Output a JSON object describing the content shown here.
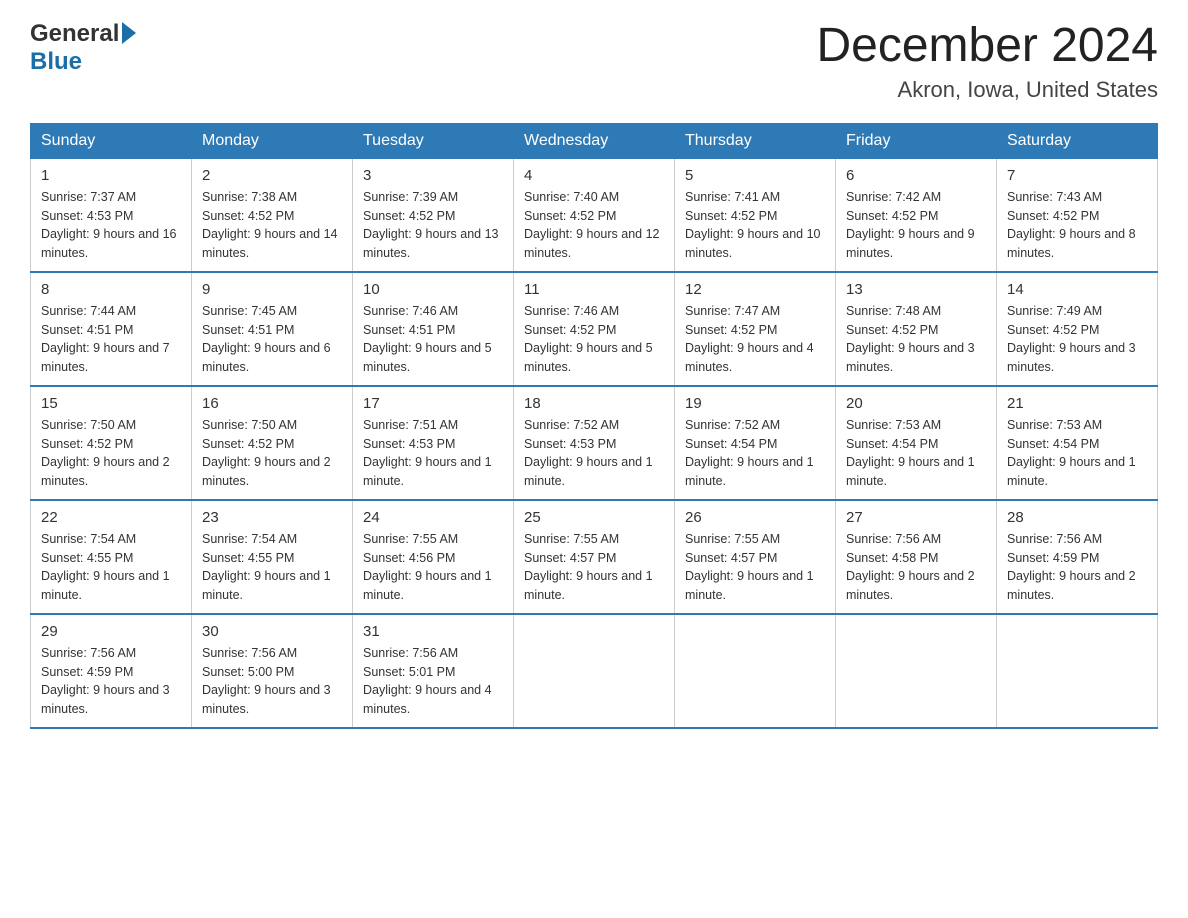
{
  "logo": {
    "general": "General",
    "blue": "Blue"
  },
  "title": "December 2024",
  "subtitle": "Akron, Iowa, United States",
  "days_of_week": [
    "Sunday",
    "Monday",
    "Tuesday",
    "Wednesday",
    "Thursday",
    "Friday",
    "Saturday"
  ],
  "weeks": [
    [
      {
        "num": "1",
        "sunrise": "7:37 AM",
        "sunset": "4:53 PM",
        "daylight": "9 hours and 16 minutes."
      },
      {
        "num": "2",
        "sunrise": "7:38 AM",
        "sunset": "4:52 PM",
        "daylight": "9 hours and 14 minutes."
      },
      {
        "num": "3",
        "sunrise": "7:39 AM",
        "sunset": "4:52 PM",
        "daylight": "9 hours and 13 minutes."
      },
      {
        "num": "4",
        "sunrise": "7:40 AM",
        "sunset": "4:52 PM",
        "daylight": "9 hours and 12 minutes."
      },
      {
        "num": "5",
        "sunrise": "7:41 AM",
        "sunset": "4:52 PM",
        "daylight": "9 hours and 10 minutes."
      },
      {
        "num": "6",
        "sunrise": "7:42 AM",
        "sunset": "4:52 PM",
        "daylight": "9 hours and 9 minutes."
      },
      {
        "num": "7",
        "sunrise": "7:43 AM",
        "sunset": "4:52 PM",
        "daylight": "9 hours and 8 minutes."
      }
    ],
    [
      {
        "num": "8",
        "sunrise": "7:44 AM",
        "sunset": "4:51 PM",
        "daylight": "9 hours and 7 minutes."
      },
      {
        "num": "9",
        "sunrise": "7:45 AM",
        "sunset": "4:51 PM",
        "daylight": "9 hours and 6 minutes."
      },
      {
        "num": "10",
        "sunrise": "7:46 AM",
        "sunset": "4:51 PM",
        "daylight": "9 hours and 5 minutes."
      },
      {
        "num": "11",
        "sunrise": "7:46 AM",
        "sunset": "4:52 PM",
        "daylight": "9 hours and 5 minutes."
      },
      {
        "num": "12",
        "sunrise": "7:47 AM",
        "sunset": "4:52 PM",
        "daylight": "9 hours and 4 minutes."
      },
      {
        "num": "13",
        "sunrise": "7:48 AM",
        "sunset": "4:52 PM",
        "daylight": "9 hours and 3 minutes."
      },
      {
        "num": "14",
        "sunrise": "7:49 AM",
        "sunset": "4:52 PM",
        "daylight": "9 hours and 3 minutes."
      }
    ],
    [
      {
        "num": "15",
        "sunrise": "7:50 AM",
        "sunset": "4:52 PM",
        "daylight": "9 hours and 2 minutes."
      },
      {
        "num": "16",
        "sunrise": "7:50 AM",
        "sunset": "4:52 PM",
        "daylight": "9 hours and 2 minutes."
      },
      {
        "num": "17",
        "sunrise": "7:51 AM",
        "sunset": "4:53 PM",
        "daylight": "9 hours and 1 minute."
      },
      {
        "num": "18",
        "sunrise": "7:52 AM",
        "sunset": "4:53 PM",
        "daylight": "9 hours and 1 minute."
      },
      {
        "num": "19",
        "sunrise": "7:52 AM",
        "sunset": "4:54 PM",
        "daylight": "9 hours and 1 minute."
      },
      {
        "num": "20",
        "sunrise": "7:53 AM",
        "sunset": "4:54 PM",
        "daylight": "9 hours and 1 minute."
      },
      {
        "num": "21",
        "sunrise": "7:53 AM",
        "sunset": "4:54 PM",
        "daylight": "9 hours and 1 minute."
      }
    ],
    [
      {
        "num": "22",
        "sunrise": "7:54 AM",
        "sunset": "4:55 PM",
        "daylight": "9 hours and 1 minute."
      },
      {
        "num": "23",
        "sunrise": "7:54 AM",
        "sunset": "4:55 PM",
        "daylight": "9 hours and 1 minute."
      },
      {
        "num": "24",
        "sunrise": "7:55 AM",
        "sunset": "4:56 PM",
        "daylight": "9 hours and 1 minute."
      },
      {
        "num": "25",
        "sunrise": "7:55 AM",
        "sunset": "4:57 PM",
        "daylight": "9 hours and 1 minute."
      },
      {
        "num": "26",
        "sunrise": "7:55 AM",
        "sunset": "4:57 PM",
        "daylight": "9 hours and 1 minute."
      },
      {
        "num": "27",
        "sunrise": "7:56 AM",
        "sunset": "4:58 PM",
        "daylight": "9 hours and 2 minutes."
      },
      {
        "num": "28",
        "sunrise": "7:56 AM",
        "sunset": "4:59 PM",
        "daylight": "9 hours and 2 minutes."
      }
    ],
    [
      {
        "num": "29",
        "sunrise": "7:56 AM",
        "sunset": "4:59 PM",
        "daylight": "9 hours and 3 minutes."
      },
      {
        "num": "30",
        "sunrise": "7:56 AM",
        "sunset": "5:00 PM",
        "daylight": "9 hours and 3 minutes."
      },
      {
        "num": "31",
        "sunrise": "7:56 AM",
        "sunset": "5:01 PM",
        "daylight": "9 hours and 4 minutes."
      },
      null,
      null,
      null,
      null
    ]
  ]
}
